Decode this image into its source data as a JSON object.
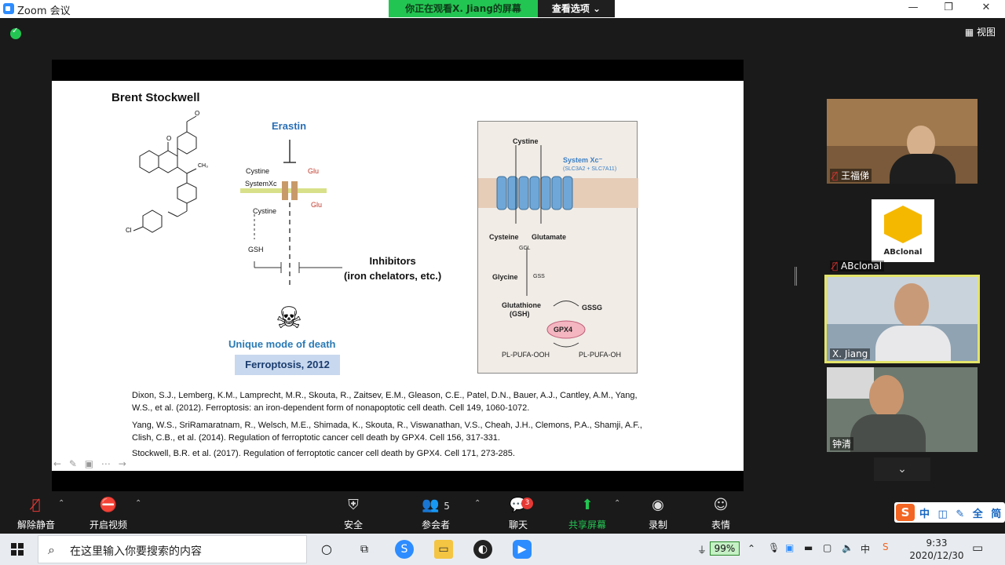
{
  "window": {
    "title": "Zoom 会议",
    "minimize": "—",
    "maximize": "❐",
    "close": "✕"
  },
  "banner": {
    "watching": "你正在观看X. Jiang的屏幕",
    "view_options": "查看选项 ⌄"
  },
  "view_button": "▦ 视图",
  "slide": {
    "author": "Brent Stockwell",
    "erastin": "Erastin",
    "cystine_top": "Cystine",
    "system_xc": "SystemXc",
    "glu1": "Glu",
    "glu2": "Glu",
    "cystine_bottom": "Cystine",
    "gsh": "GSH",
    "inhibitors_line1": "Inhibitors",
    "inhibitors_line2": "(iron chelators, etc.)",
    "unique_mode": "Unique mode of death",
    "ferroptosis": "Ferroptosis, 2012",
    "panel": {
      "cystine": "Cystine",
      "system": "System Xc⁻",
      "system_sub": "(SLC3A2 + SLC7A11)",
      "cysteine": "Cysteine",
      "glutamate": "Glutamate",
      "gcl": "GCL",
      "glycine": "Glycine",
      "gss": "GSS",
      "glutathione": "Glutathione",
      "gsh": "(GSH)",
      "gssg": "GSSG",
      "gpx4": "GPX4",
      "pl_pufa_ooh": "PL-PUFA-OOH",
      "pl_pufa_oh": "PL-PUFA-OH"
    },
    "refs": [
      "Dixon, S.J., Lemberg, K.M., Lamprecht, M.R., Skouta, R., Zaitsev, E.M., Gleason, C.E., Patel, D.N., Bauer, A.J., Cantley, A.M., Yang, W.S., et al. (2012). Ferroptosis: an iron-dependent form of nonapoptotic cell death. Cell 149, 1060-1072.",
      "Yang, W.S., SriRamaratnam, R., Welsch, M.E., Shimada, K., Skouta, R., Viswanathan, V.S., Cheah, J.H., Clemons, P.A., Shamji, A.F., Clish, C.B., et al. (2014). Regulation of ferroptotic cancer cell death by GPX4. Cell 156, 317-331.",
      "Stockwell, B.R. et al. (2017). Regulation of ferroptotic cancer cell death by GPX4. Cell 171, 273-285."
    ],
    "nav": "← ✎ ▣ ⋯ →"
  },
  "participants": [
    {
      "name": "王福俤",
      "muted": true
    },
    {
      "name": "ABclonal",
      "muted": true,
      "logo_text": "ABclonal"
    },
    {
      "name": "X. Jiang",
      "active": true
    },
    {
      "name": "钟清"
    }
  ],
  "toolbar": {
    "unmute": "解除静音",
    "start_video": "开启视频",
    "security": "安全",
    "participants": "参会者",
    "participants_count": "5",
    "chat": "聊天",
    "chat_badge": "3",
    "share": "共享屏幕",
    "record": "录制",
    "reactions": "表情"
  },
  "ime": {
    "logo": "S",
    "text": "中 ◫ ✎ 全 简"
  },
  "taskbar": {
    "search_placeholder": "在这里输入你要搜索的内容",
    "battery": "99%",
    "ime_indicator": "中",
    "time": "9:33",
    "date": "2020/12/30"
  },
  "colors": {
    "zoom_blue": "#2d8cff",
    "banner_green": "#23c552",
    "active_border": "#e4e46a",
    "badge_red": "#e53935"
  }
}
